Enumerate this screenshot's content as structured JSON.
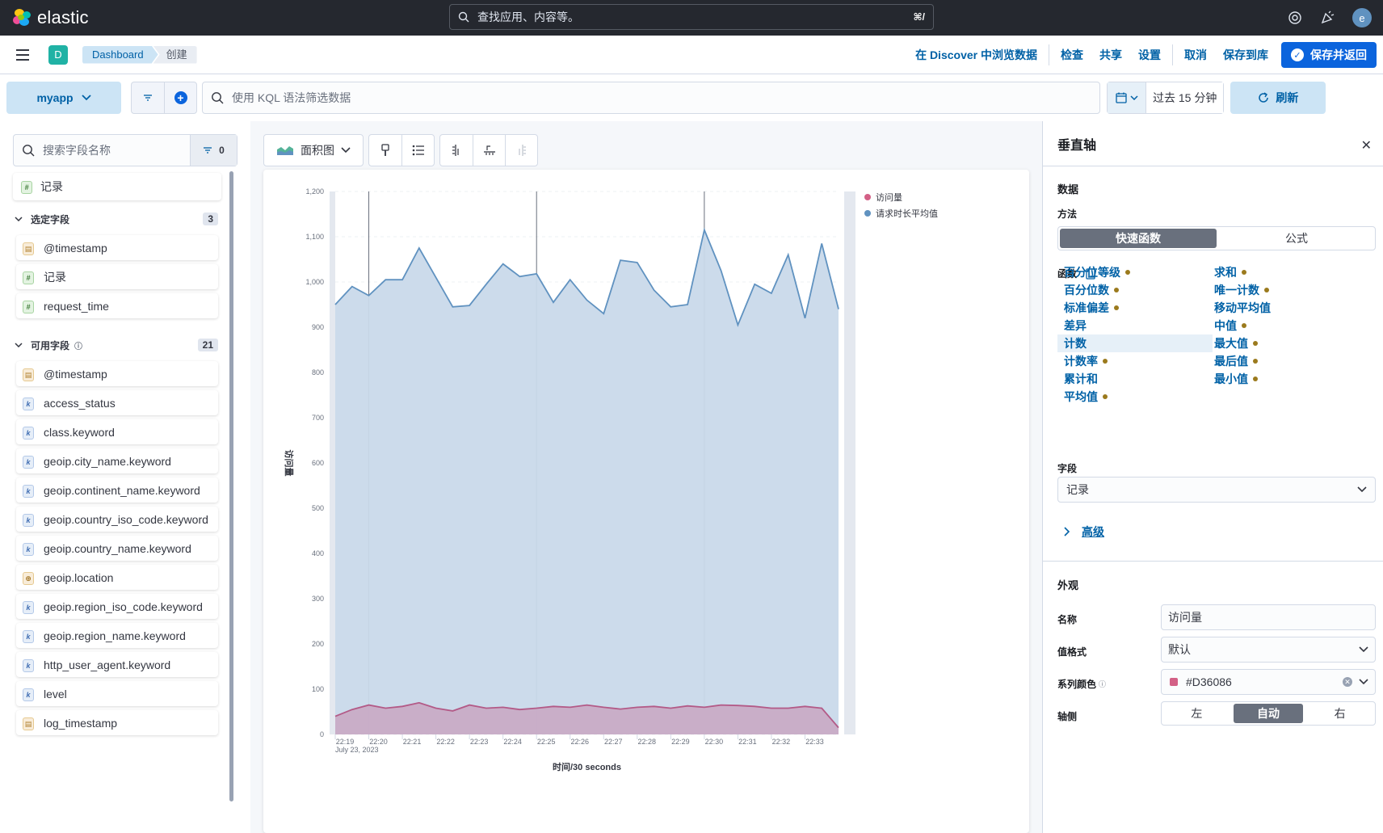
{
  "topbar": {
    "brand": "elastic",
    "search_placeholder": "查找应用、内容等。",
    "search_shortcut": "⌘/",
    "user_initial": "e"
  },
  "header": {
    "space_initial": "D",
    "breadcrumbs": [
      "Dashboard",
      "创建"
    ],
    "actions": [
      "在 Discover 中浏览数据",
      "检查",
      "共享",
      "设置",
      "取消",
      "保存到库"
    ],
    "primary_action": "保存并返回"
  },
  "querybar": {
    "data_view": "myapp",
    "kql_placeholder": "使用 KQL 语法筛选数据",
    "time_range": "过去 15 分钟",
    "refresh_label": "刷新"
  },
  "fieldlist": {
    "search_placeholder": "搜索字段名称",
    "filter_count": "0",
    "records_label": "记录",
    "selected_title": "选定字段",
    "selected_count": "3",
    "selected_fields": [
      {
        "type": "date",
        "name": "@timestamp"
      },
      {
        "type": "number",
        "name": "记录"
      },
      {
        "type": "number",
        "name": "request_time"
      }
    ],
    "available_title": "可用字段",
    "available_count": "21",
    "available_fields": [
      {
        "type": "date",
        "name": "@timestamp"
      },
      {
        "type": "keyword",
        "name": "access_status"
      },
      {
        "type": "keyword",
        "name": "class.keyword"
      },
      {
        "type": "keyword",
        "name": "geoip.city_name.keyword"
      },
      {
        "type": "keyword",
        "name": "geoip.continent_name.keyword"
      },
      {
        "type": "keyword",
        "name": "geoip.country_iso_code.keyword"
      },
      {
        "type": "keyword",
        "name": "geoip.country_name.keyword"
      },
      {
        "type": "geo",
        "name": "geoip.location"
      },
      {
        "type": "keyword",
        "name": "geoip.region_iso_code.keyword"
      },
      {
        "type": "keyword",
        "name": "geoip.region_name.keyword"
      },
      {
        "type": "keyword",
        "name": "http_user_agent.keyword"
      },
      {
        "type": "keyword",
        "name": "level"
      },
      {
        "type": "date",
        "name": "log_timestamp"
      }
    ]
  },
  "chart_toolbar": {
    "chart_type": "面积图"
  },
  "chart_data": {
    "type": "area",
    "xlabel": "时间/30 seconds",
    "ylabel": "访问量",
    "ylim": [
      0,
      1200
    ],
    "yticks": [
      0,
      100,
      200,
      300,
      400,
      500,
      600,
      700,
      800,
      900,
      1000,
      1100,
      1200
    ],
    "x_ticks": [
      "22:19",
      "22:20",
      "22:21",
      "22:22",
      "22:23",
      "22:24",
      "22:25",
      "22:26",
      "22:27",
      "22:28",
      "22:29",
      "22:30",
      "22:31",
      "22:32",
      "22:33"
    ],
    "x_subtitle": "July 23, 2023",
    "legend_position": "top-right",
    "series": [
      {
        "name": "访问量",
        "color": "#D36086",
        "values": [
          40,
          55,
          65,
          58,
          62,
          70,
          58,
          52,
          65,
          58,
          60,
          55,
          58,
          62,
          60,
          65,
          60,
          56,
          60,
          62,
          58,
          63,
          60,
          65,
          64,
          62,
          58,
          58,
          62,
          58,
          15
        ]
      },
      {
        "name": "请求时长平均值",
        "color": "#6092C0",
        "values": [
          950,
          990,
          970,
          1005,
          1005,
          1075,
          1010,
          945,
          948,
          995,
          1040,
          1012,
          1018,
          955,
          1005,
          960,
          930,
          1048,
          1043,
          982,
          945,
          950,
          1115,
          1025,
          905,
          995,
          975,
          1060,
          920,
          1085,
          940
        ]
      }
    ]
  },
  "right_panel": {
    "title": "垂直轴",
    "data_section": "数据",
    "method_label": "方法",
    "method_options": [
      "快速函数",
      "公式"
    ],
    "functions_label": "函数",
    "functions_left": [
      {
        "name": "百分位等级",
        "dot": true
      },
      {
        "name": "百分位数",
        "dot": true
      },
      {
        "name": "标准偏差",
        "dot": true
      },
      {
        "name": "差异",
        "dot": false
      },
      {
        "name": "计数",
        "dot": false
      },
      {
        "name": "计数率",
        "dot": true
      },
      {
        "name": "累计和",
        "dot": false
      },
      {
        "name": "平均值",
        "dot": true
      }
    ],
    "functions_right": [
      {
        "name": "求和",
        "dot": true
      },
      {
        "name": "唯一计数",
        "dot": true
      },
      {
        "name": "移动平均值",
        "dot": false
      },
      {
        "name": "中值",
        "dot": true
      },
      {
        "name": "最大值",
        "dot": true
      },
      {
        "name": "最后值",
        "dot": true
      },
      {
        "name": "最小值",
        "dot": true
      }
    ],
    "selected_function": "计数",
    "field_label": "字段",
    "field_value": "记录",
    "advanced_label": "高级",
    "appearance_section": "外观",
    "name_label": "名称",
    "name_value": "访问量",
    "format_label": "值格式",
    "format_value": "默认",
    "color_label": "系列颜色",
    "color_value": "#D36086",
    "axis_side_label": "轴侧",
    "axis_side_options": [
      "左",
      "自动",
      "右"
    ],
    "axis_side_selected": "自动"
  }
}
